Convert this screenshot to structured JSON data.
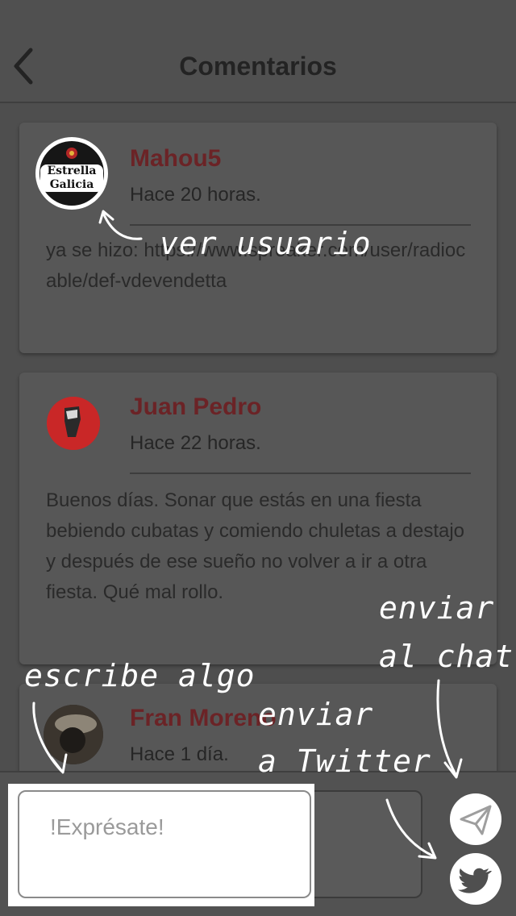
{
  "navbar": {
    "title": "Comentarios",
    "back_icon": "chevron-left-icon"
  },
  "comments": [
    {
      "author": "Mahou5",
      "time": "Hace 20 horas.",
      "text": "ya se hizo: https://www.spreaker.com/user/radiocable/def-vdevendetta",
      "avatar_text_1": "Estrella",
      "avatar_text_2": "Galicia"
    },
    {
      "author": "Juan Pedro",
      "time": "Hace 22 horas.",
      "text": "Buenos días. Sonar que estás en una fiesta bebiendo cubatas y comiendo chuletas a destajo y después de ese sueño no volver a ir a otra fiesta. Qué mal rollo."
    },
    {
      "author": "Fran Moreno",
      "time": "Hace 1 día."
    }
  ],
  "composer": {
    "placeholder": "!Exprésate!",
    "send_icon": "paper-plane-icon",
    "twitter_icon": "twitter-bird-icon"
  },
  "annotations": {
    "ver_usuario": "ver usuario",
    "escribe_algo": "escribe algo",
    "enviar_twitter_1": "enviar",
    "enviar_twitter_2": "a Twitter",
    "enviar_chat_1": "enviar",
    "enviar_chat_2": "al chat"
  },
  "colors": {
    "author": "#6b2326",
    "overlay": "#4e4e4e",
    "accent_white": "#ffffff"
  }
}
